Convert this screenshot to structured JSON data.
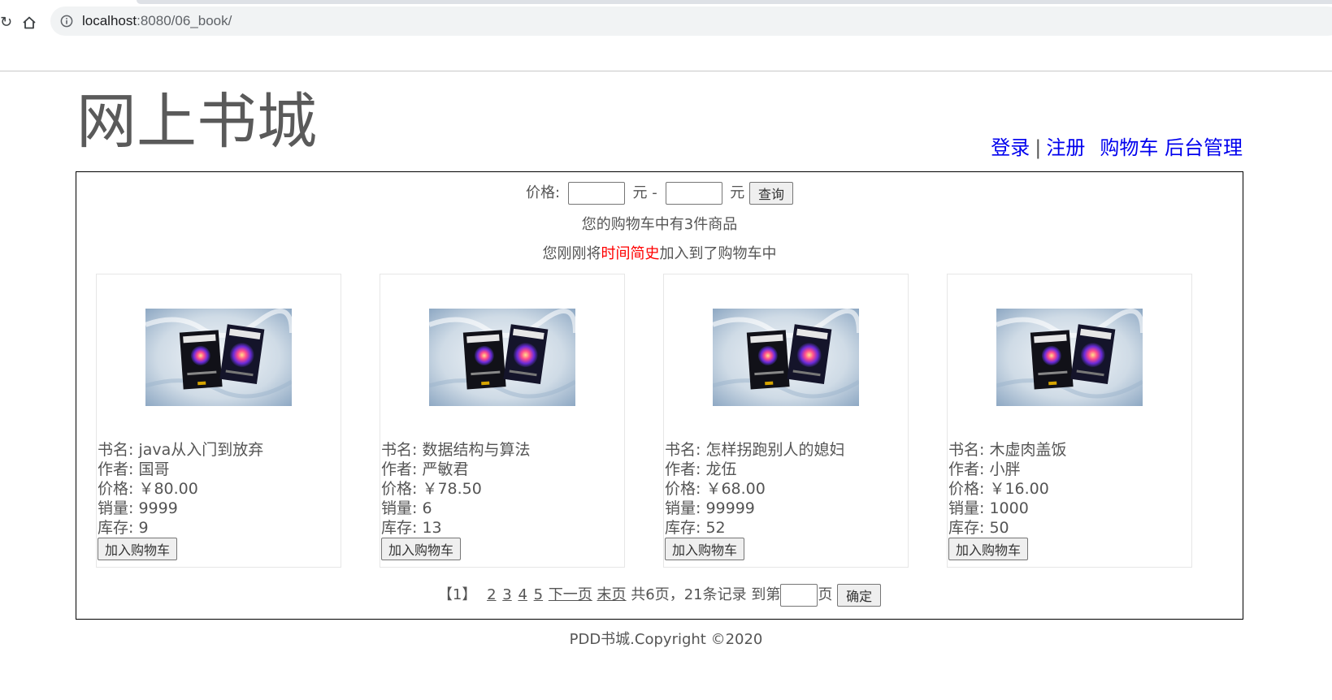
{
  "browser": {
    "url_host": "localhost",
    "url_path": ":8080/06_book/"
  },
  "site": {
    "title": "网上书城"
  },
  "nav": {
    "login": "登录",
    "separator": "|",
    "register": "注册",
    "cart": "购物车",
    "admin": "后台管理"
  },
  "search": {
    "price_label": "价格:",
    "min_value": "",
    "unit1": "元 -",
    "max_value": "",
    "unit2": "元",
    "query_button": "查询"
  },
  "cart_info": "您的购物车中有3件商品",
  "recent": {
    "prefix": "您刚刚将",
    "book": "时间简史",
    "suffix": "加入到了购物车中"
  },
  "books": [
    {
      "name": "书名: java从入门到放弃",
      "author": "作者: 国哥",
      "price": "价格: ￥80.00",
      "sales": "销量: 9999",
      "stock": "库存: 9",
      "button": "加入购物车"
    },
    {
      "name": "书名: 数据结构与算法",
      "author": "作者: 严敏君",
      "price": "价格: ￥78.50",
      "sales": "销量: 6",
      "stock": "库存: 13",
      "button": "加入购物车"
    },
    {
      "name": "书名: 怎样拐跑别人的媳妇",
      "author": "作者: 龙伍",
      "price": "价格: ￥68.00",
      "sales": "销量: 99999",
      "stock": "库存: 52",
      "button": "加入购物车"
    },
    {
      "name": "书名: 木虚肉盖饭",
      "author": "作者: 小胖",
      "price": "价格: ￥16.00",
      "sales": "销量: 1000",
      "stock": "库存: 50",
      "button": "加入购物车"
    }
  ],
  "pager": {
    "current": "【1】",
    "pages": [
      "2",
      "3",
      "4",
      "5"
    ],
    "next": "下一页",
    "last": "末页",
    "summary": "共6页，21条记录",
    "goto_prefix": "到第",
    "goto_value": "",
    "goto_suffix": "页",
    "confirm": "确定"
  },
  "footer": "PDD书城.Copyright ©2020",
  "colors": {
    "link": "#0000ee",
    "highlight": "#ff0000",
    "text": "#555555"
  }
}
